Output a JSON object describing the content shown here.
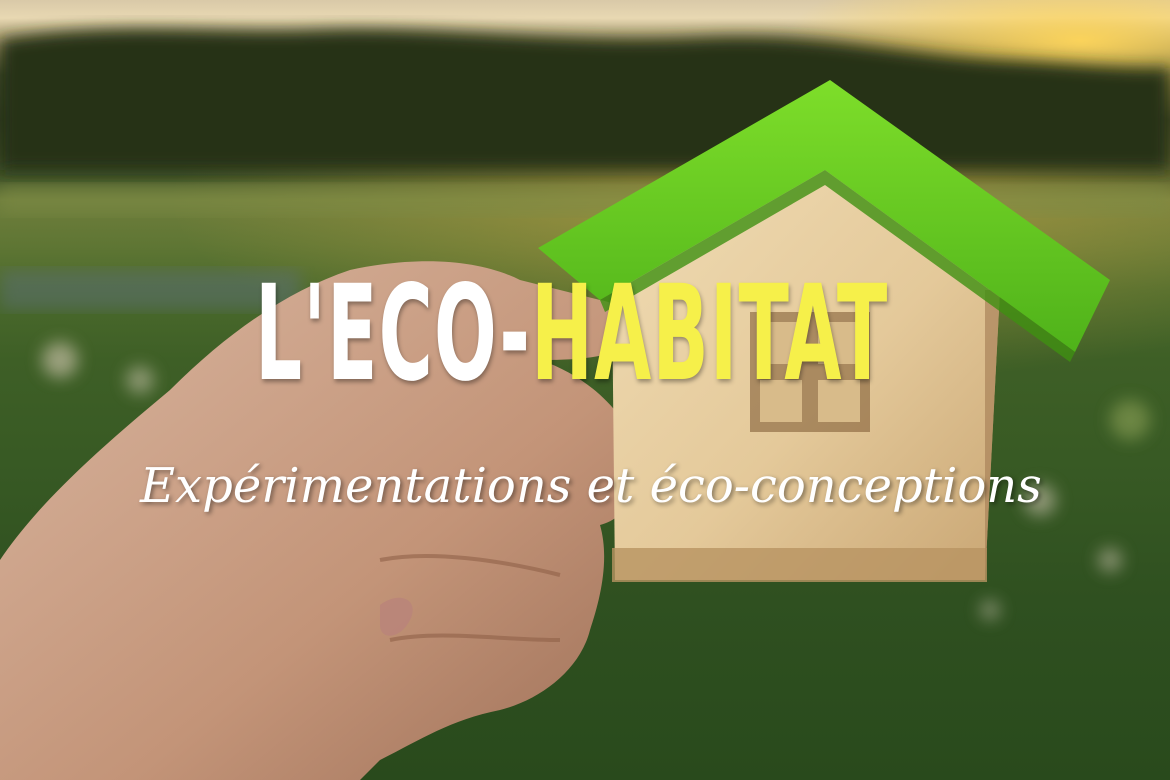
{
  "title": {
    "part_white": "L'ECO-",
    "part_yellow": "HABITAT"
  },
  "subtitle": "Expérimentations et éco-conceptions",
  "colors": {
    "title_white": "#ffffff",
    "title_yellow": "#f6f04a",
    "roof_green": "#5ac71f",
    "wood": "#e6cfa3"
  }
}
